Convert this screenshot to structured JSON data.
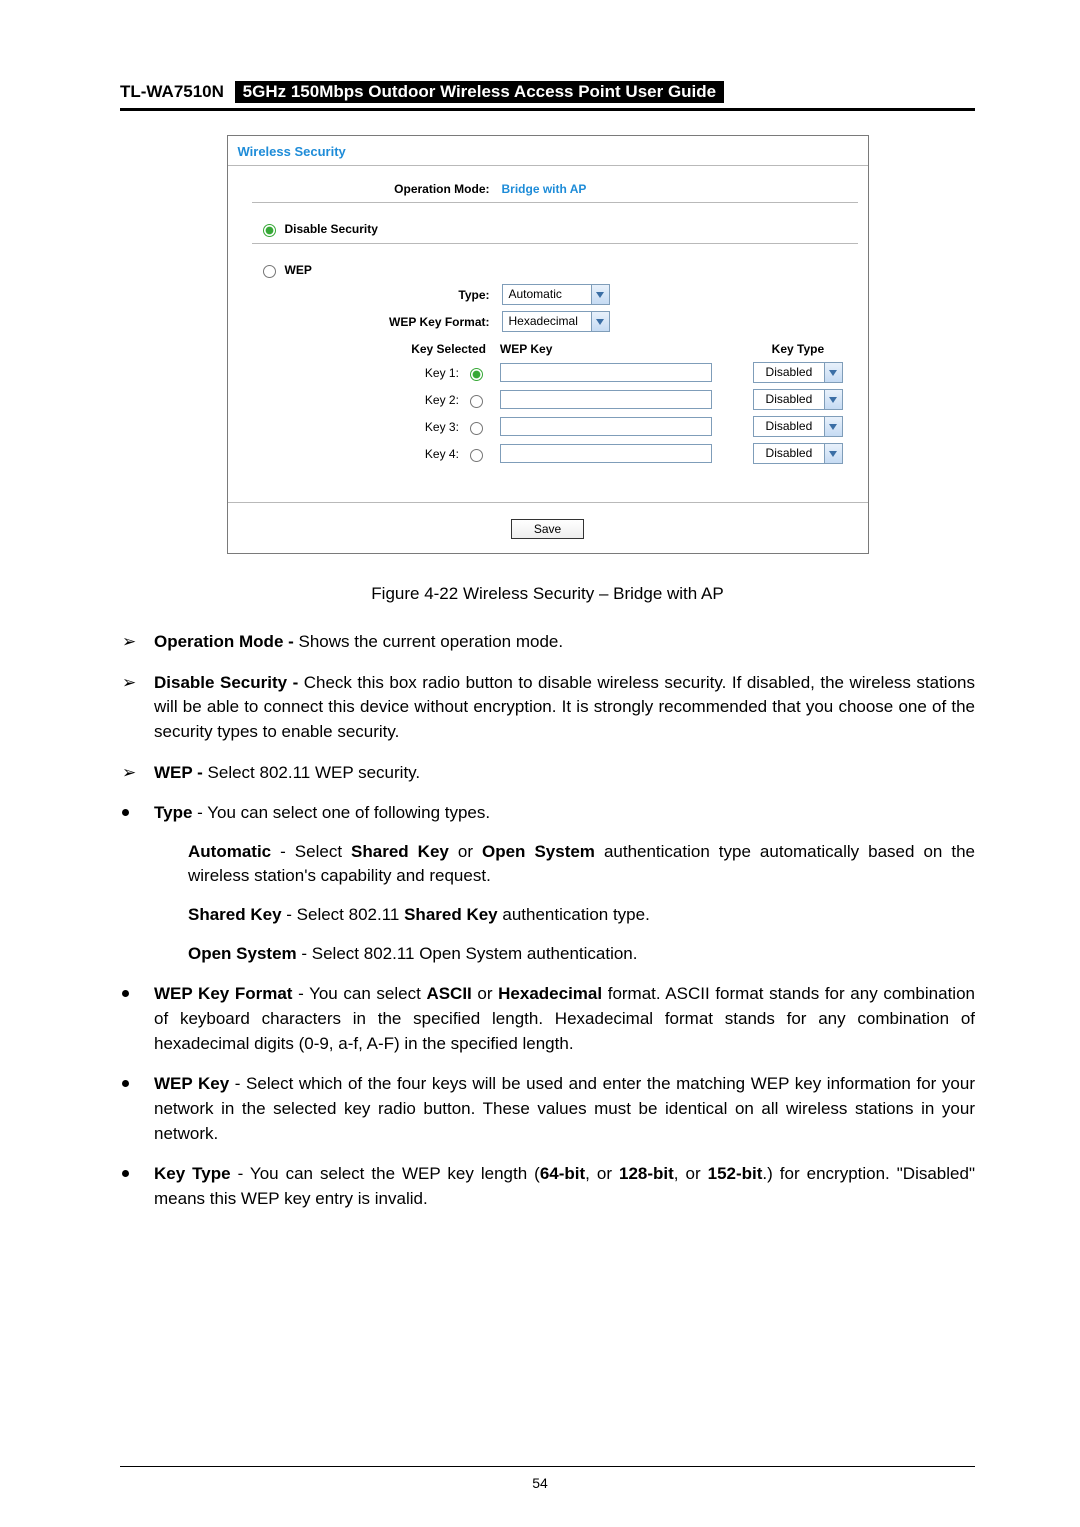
{
  "header": {
    "model": "TL-WA7510N",
    "title": "5GHz 150Mbps Outdoor Wireless Access Point User Guide"
  },
  "panel": {
    "title": "Wireless Security",
    "operation_mode_label": "Operation Mode:",
    "operation_mode_value": "Bridge with AP",
    "disable_security_label": "Disable Security",
    "wep_label": "WEP",
    "type_label": "Type:",
    "type_value": "Automatic",
    "format_label": "WEP Key Format:",
    "format_value": "Hexadecimal",
    "col_key_selected": "Key Selected",
    "col_wep_key": "WEP Key",
    "col_key_type": "Key Type",
    "keys": [
      {
        "label": "Key 1:",
        "type": "Disabled"
      },
      {
        "label": "Key 2:",
        "type": "Disabled"
      },
      {
        "label": "Key 3:",
        "type": "Disabled"
      },
      {
        "label": "Key 4:",
        "type": "Disabled"
      }
    ],
    "save_label": "Save"
  },
  "caption": "Figure 4-22 Wireless Security – Bridge with AP",
  "text": {
    "op_mode_b": "Operation Mode -",
    "op_mode_r": " Shows the current operation mode.",
    "disable_b": "Disable Security -",
    "disable_r": " Check this box radio button to disable wireless security. If disabled, the wireless stations will be able to connect this device without encryption. It is strongly recommended that you choose one of the security types to enable security.",
    "wep_b": "WEP -",
    "wep_r": " Select 802.11 WEP security.",
    "type_b": "Type",
    "type_r": " - You can select one of following types.",
    "auto_b": "Automatic",
    "auto_mid": " - Select ",
    "shared_key_b": "Shared Key",
    "or_txt": " or ",
    "open_sys_b": "Open System",
    "auto_tail": " authentication type automatically based on the wireless station's capability and request.",
    "sk_b": "Shared Key",
    "sk_mid": " - Select 802.11 ",
    "sk_b2": "Shared Key",
    "sk_tail": " authentication type.",
    "os_b": "Open System",
    "os_r": " - Select 802.11 Open System authentication.",
    "fmt_b": "WEP Key Format",
    "fmt_mid": " - You can select ",
    "ascii_b": "ASCII",
    "fmt_or": " or ",
    "hex_b": "Hexadecimal",
    "fmt_tail": " format. ASCII format stands for any combination of keyboard characters in the specified length. Hexadecimal format stands for any combination of hexadecimal digits (0-9, a-f, A-F) in the specified length.",
    "wepkey_b": "WEP Key",
    "wepkey_r": " - Select which of the four keys will be used and enter the matching WEP key information for your network in the selected key radio button. These values must be identical on all wireless stations in your network.",
    "keytype_b": "Key Type",
    "keytype_mid": " - You can select the WEP key length (",
    "kt64": "64-bit",
    "kt_c1": ", or ",
    "kt128": "128-bit",
    "kt_c2": ", or ",
    "kt152": "152-bit",
    "keytype_tail": ".) for encryption. \"Disabled\" means this WEP key entry is invalid."
  },
  "page_number": "54"
}
